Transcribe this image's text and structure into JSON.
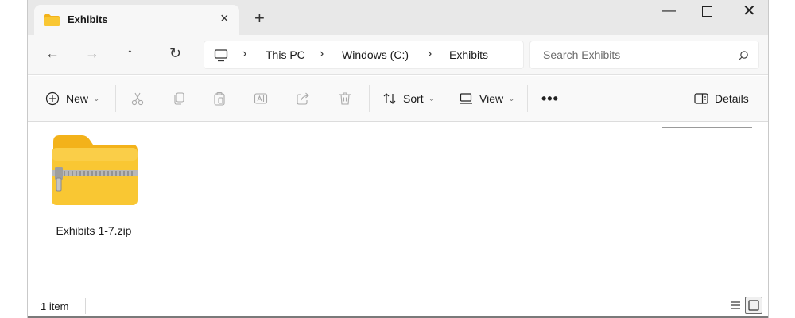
{
  "tab": {
    "title": "Exhibits",
    "close_glyph": "×",
    "new_tab_glyph": "+"
  },
  "window_controls": {
    "minimize": "—",
    "close": "✕"
  },
  "nav": {
    "back": "←",
    "forward": "→",
    "up": "↑",
    "refresh": "↻",
    "breadcrumb": [
      "This PC",
      "Windows (C:)",
      "Exhibits"
    ],
    "separator": "›"
  },
  "search": {
    "placeholder": "Search Exhibits"
  },
  "commands": {
    "new_label": "New",
    "sort_label": "Sort",
    "view_label": "View",
    "more": "•••",
    "details_label": "Details",
    "chevron": "⌄"
  },
  "files": [
    {
      "name": "Exhibits 1-7.zip",
      "icon": "zip-folder-icon"
    }
  ],
  "status": {
    "item_count": "1 item"
  },
  "colors": {
    "folder": "#f9c733",
    "folder_back": "#f3b21a",
    "accent": "#0067c0"
  }
}
